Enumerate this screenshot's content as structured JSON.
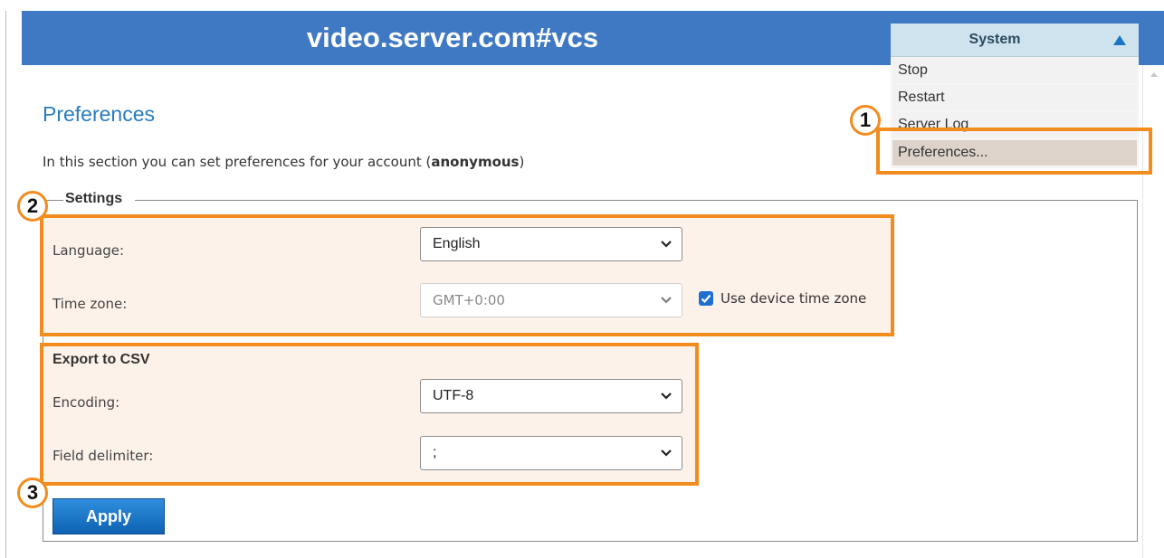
{
  "header": {
    "title": "video.server.com#vcs"
  },
  "system_menu": {
    "label": "System",
    "items": [
      {
        "label": "Stop"
      },
      {
        "label": "Restart"
      },
      {
        "label": "Server Log"
      },
      {
        "label": "Preferences..."
      }
    ]
  },
  "page": {
    "title": "Preferences",
    "intro_prefix": "In this section you can set preferences for your account (",
    "account": "anonymous",
    "intro_suffix": ")"
  },
  "settings": {
    "legend": "Settings",
    "language_label": "Language:",
    "language_value": "English",
    "timezone_label": "Time zone:",
    "timezone_value": "GMT+0:00",
    "use_device_tz_label": "Use device time zone",
    "use_device_tz_checked": true
  },
  "export_csv": {
    "heading": "Export to CSV",
    "encoding_label": "Encoding:",
    "encoding_value": "UTF-8",
    "delimiter_label": "Field delimiter:",
    "delimiter_value": ";"
  },
  "apply_label": "Apply",
  "callouts": {
    "one": "1",
    "two": "2",
    "three": "3"
  },
  "colors": {
    "header": "#3f79c4",
    "highlight": "#f28c1e",
    "link": "#2a7cc0",
    "button": "#1668bb"
  }
}
